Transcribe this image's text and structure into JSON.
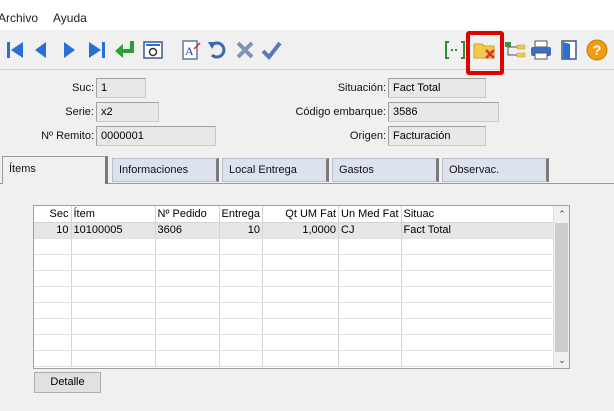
{
  "menu": {
    "items": [
      "Archivo",
      "Ayuda"
    ],
    "title_fragment": "- - -"
  },
  "toolbar": {
    "icons": [
      "first-icon",
      "prev-icon",
      "next-icon",
      "last-icon",
      "enter-icon",
      "preview-icon",
      "text-edit-icon",
      "undo-icon",
      "delete-icon",
      "confirm-icon",
      "bracket-icon",
      "folder-cancel-icon",
      "tree-icon",
      "print-icon",
      "exit-door-icon",
      "help-icon"
    ],
    "help_label": "?"
  },
  "form": {
    "suc_label": "Suc:",
    "suc_value": "1",
    "serie_label": "Serie:",
    "serie_value": "x2",
    "remito_label": "Nº Remito:",
    "remito_value": "0000001",
    "situacion_label": "Situación:",
    "situacion_value": "Fact Total",
    "codigo_label": "Código embarque:",
    "codigo_value": "3586",
    "origen_label": "Origen:",
    "origen_value": "Facturación"
  },
  "tabs": [
    "Ítems",
    "Informaciones",
    "Local Entrega",
    "Gastos",
    "Observac."
  ],
  "grid": {
    "columns": [
      "Sec",
      "Ítem",
      "Nº Pedido",
      "Entrega",
      "Qt UM Fat",
      "Un Med Fat",
      "Situac"
    ],
    "rows": [
      [
        "10",
        "10100005",
        "3606",
        "10",
        "1,0000",
        "CJ",
        "Fact Total"
      ]
    ],
    "scroll_up": "⌃",
    "scroll_down": "⌄"
  },
  "detalle_button": "Detalle",
  "colors": {
    "highlight": "#e00000",
    "nav_blue": "#2a6fd6",
    "green": "#2f9e2f",
    "help": "#f39c12"
  }
}
